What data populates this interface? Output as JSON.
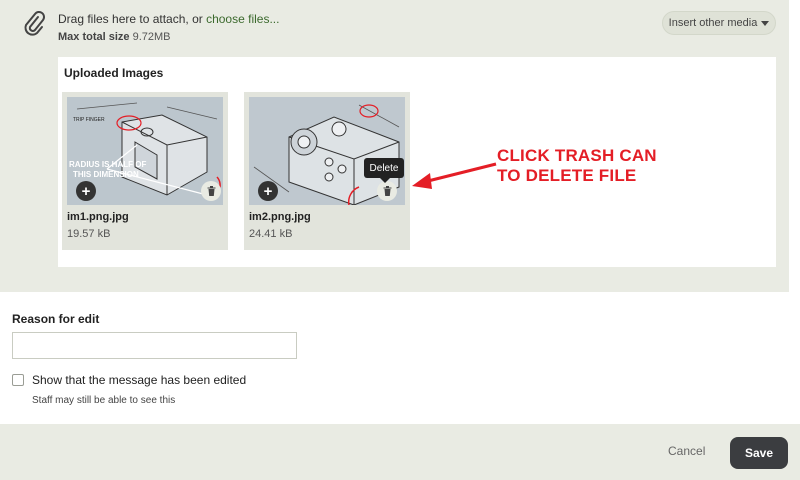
{
  "attachments": {
    "drag_text": "Drag files here to attach, or ",
    "choose_link": "choose files...",
    "max_size_label": "Max total size",
    "max_size_value": "9.72MB",
    "insert_media_label": "Insert other media",
    "icon": "paperclip-icon"
  },
  "uploaded": {
    "title": "Uploaded Images",
    "files": [
      {
        "name": "im1.png.jpg",
        "size": "19.57 kB",
        "thumb_labels": [
          "TRIP FINGER",
          "RADIUS IS HALF OF",
          "THIS DIMENSION"
        ]
      },
      {
        "name": "im2.png.jpg",
        "size": "24.41 kB"
      }
    ],
    "delete_tooltip": "Delete"
  },
  "annotation": {
    "line1": "CLICK TRASH CAN",
    "line2": "TO DELETE FILE",
    "color": "#e41e26"
  },
  "edit": {
    "reason_label": "Reason for edit",
    "reason_value": "",
    "show_edited_label": "Show that the message has been edited",
    "show_edited_checked": false,
    "staff_hint": "Staff may still be able to see this"
  },
  "footer": {
    "cancel_label": "Cancel",
    "save_label": "Save"
  },
  "colors": {
    "panel_bg": "#e9ebe3",
    "accent_link": "#3c6a2e",
    "save_bg": "#3b3d40"
  }
}
